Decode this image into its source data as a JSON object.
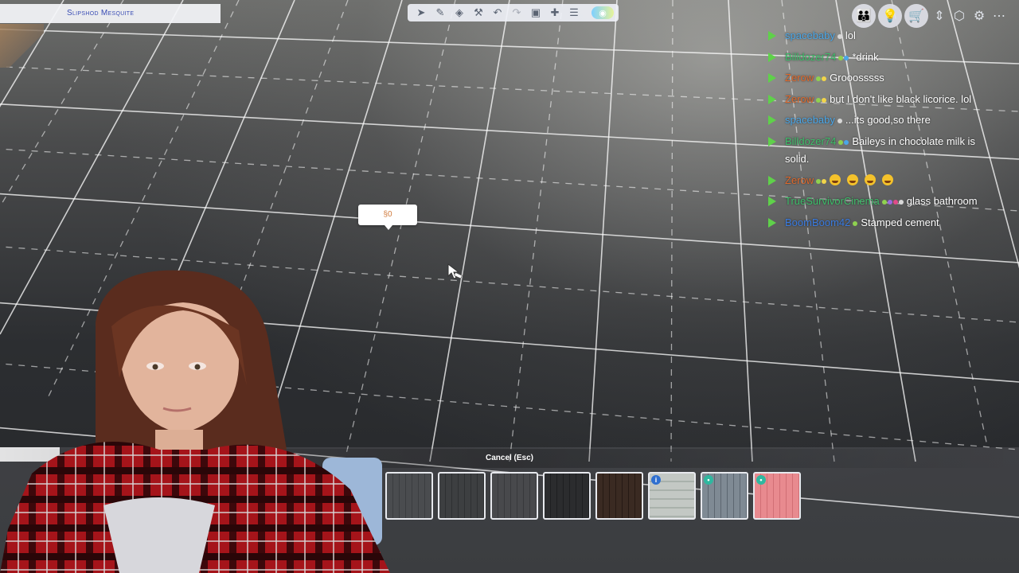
{
  "lot": {
    "name": "Slipshod Mesquite"
  },
  "toolbar": {
    "icons": [
      "select-icon",
      "eyedropper-icon",
      "design-tool-icon",
      "sledgehammer-icon",
      "undo-icon",
      "redo-icon",
      "place-icon",
      "move-icon",
      "floor-level-icon",
      "camera-view-icon"
    ]
  },
  "top_right": {
    "icons": [
      "household-icon",
      "lightbulb-icon",
      "cart-icon",
      "level-arrows-icon",
      "cube-icon",
      "manage-worlds-icon",
      "menu-icon"
    ]
  },
  "chat": {
    "messages": [
      {
        "user": "spacebaby",
        "color": "#4aa7e8",
        "badges": [
          "#d8d8d8"
        ],
        "text": "lol"
      },
      {
        "user": "Billdozer74",
        "color": "#3dbf6a",
        "badges": [
          "#8fd14f",
          "#4aa7e8"
        ],
        "text": "*drink"
      },
      {
        "user": "Zerow",
        "color": "#e0692b",
        "badges": [
          "#8fd14f",
          "#f1d44a"
        ],
        "text": "Grooosssss"
      },
      {
        "user": "Zerow",
        "color": "#e0692b",
        "badges": [
          "#8fd14f",
          "#f1d44a"
        ],
        "text": "but I don't like black licorice. lol"
      },
      {
        "user": "spacebaby",
        "color": "#4aa7e8",
        "badges": [
          "#d8d8d8"
        ],
        "text": "...its good,so there"
      },
      {
        "user": "Billdozer74",
        "color": "#3dbf6a",
        "badges": [
          "#8fd14f",
          "#4aa7e8"
        ],
        "text": "Baileys in chocolate milk is solid."
      },
      {
        "user": "Zerow",
        "color": "#e0692b",
        "badges": [
          "#8fd14f",
          "#f1d44a"
        ],
        "text": "",
        "emotes": 4
      },
      {
        "user": "TrueSurvivorCinema",
        "color": "#3dbf6a",
        "badges": [
          "#8fd14f",
          "#9b6ae0",
          "#e04a8a",
          "#d8d8d8"
        ],
        "text": "glass bathroom"
      },
      {
        "user": "BoomBoom42",
        "color": "#3a7be0",
        "badges": [
          "#8fd14f"
        ],
        "text": "Stamped cement"
      }
    ]
  },
  "price_tag": {
    "value": "§0"
  },
  "cancel": {
    "label": "Cancel (Esc)"
  },
  "swatches": [
    {
      "name": "swatch-1",
      "colors": [
        "#3c3e41",
        "#2f3134"
      ],
      "selected": true,
      "badge": ""
    },
    {
      "name": "swatch-2",
      "colors": [
        "#4a4c4f",
        "#3b3d40"
      ],
      "selected": false,
      "badge": ""
    },
    {
      "name": "swatch-3",
      "colors": [
        "#3d3f41",
        "#2e3032"
      ],
      "selected": false,
      "badge": ""
    },
    {
      "name": "swatch-4",
      "colors": [
        "#48494c",
        "#38393c"
      ],
      "selected": false,
      "badge": ""
    },
    {
      "name": "swatch-5",
      "colors": [
        "#2b2c2e",
        "#1e1f21"
      ],
      "selected": false,
      "badge": ""
    },
    {
      "name": "swatch-6",
      "colors": [
        "#3a2a22",
        "#261a14"
      ],
      "selected": false,
      "badge": ""
    },
    {
      "name": "swatch-7",
      "colors": [
        "#c3c8c4",
        "#a9b1ab"
      ],
      "selected": false,
      "badge": "info",
      "badge_color": "#2f6fd0"
    },
    {
      "name": "swatch-8",
      "colors": [
        "#7f8a94",
        "#5c6670"
      ],
      "selected": false,
      "badge": "pack",
      "badge_color": "#2fb8a0"
    },
    {
      "name": "swatch-9",
      "colors": [
        "#e88a8f",
        "#d16f75"
      ],
      "selected": false,
      "badge": "pack",
      "badge_color": "#2fb8a0"
    }
  ]
}
